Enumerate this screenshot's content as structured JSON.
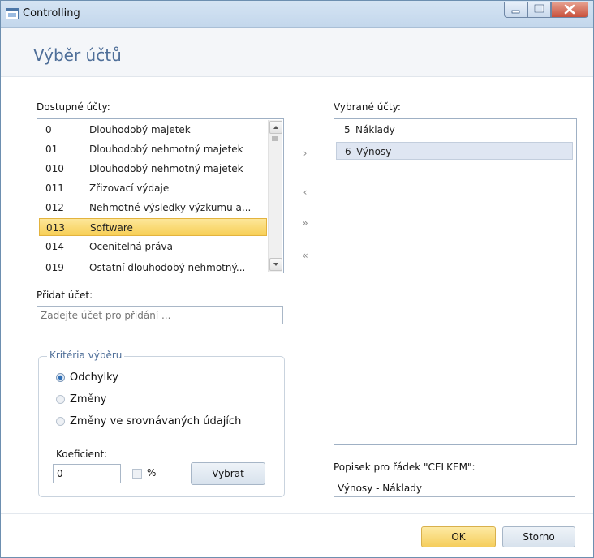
{
  "window": {
    "title": "Controlling"
  },
  "header": {
    "title": "Výběr účtů"
  },
  "available": {
    "label": "Dostupné účty:",
    "rows": [
      {
        "code": "0",
        "name": "Dlouhodobý majetek"
      },
      {
        "code": "01",
        "name": "Dlouhodobý nehmotný majetek"
      },
      {
        "code": "010",
        "name": "Dlouhodobý nehmotný majetek"
      },
      {
        "code": "011",
        "name": "Zřizovací výdaje"
      },
      {
        "code": "012",
        "name": "Nehmotné výsledky výzkumu a..."
      },
      {
        "code": "013",
        "name": "Software"
      },
      {
        "code": "014",
        "name": "Ocenitelná práva"
      },
      {
        "code": "019",
        "name": "Ostatní dlouhodobý nehmotný..."
      }
    ],
    "selected_index": 5
  },
  "transfer_buttons": {
    "add": "›",
    "remove": "‹",
    "add_all": "»",
    "remove_all": "«"
  },
  "chosen": {
    "label": "Vybrané účty:",
    "rows": [
      {
        "code": "5",
        "name": "Náklady"
      },
      {
        "code": "6",
        "name": "Výnosy"
      }
    ],
    "selected_index": 1
  },
  "add_account": {
    "label": "Přidat účet:",
    "placeholder": "Zadejte účet pro přidání ..."
  },
  "criteria": {
    "legend": "Kritéria výběru",
    "options": [
      "Odchylky",
      "Změny",
      "Změny ve srovnávaných údajích"
    ],
    "selected_index": 0,
    "coef_label": "Koeficient:",
    "coef_value": "0",
    "percent_label": "%",
    "percent_checked": false,
    "select_button": "Vybrat"
  },
  "total": {
    "label": "Popisek pro řádek \"CELKEM\":",
    "value": "Výnosy - Náklady"
  },
  "footer": {
    "ok": "OK",
    "cancel": "Storno"
  },
  "colors": {
    "accent_title": "#4f6f99",
    "selection": "#f7cf56",
    "close_button": "#c9513c"
  }
}
